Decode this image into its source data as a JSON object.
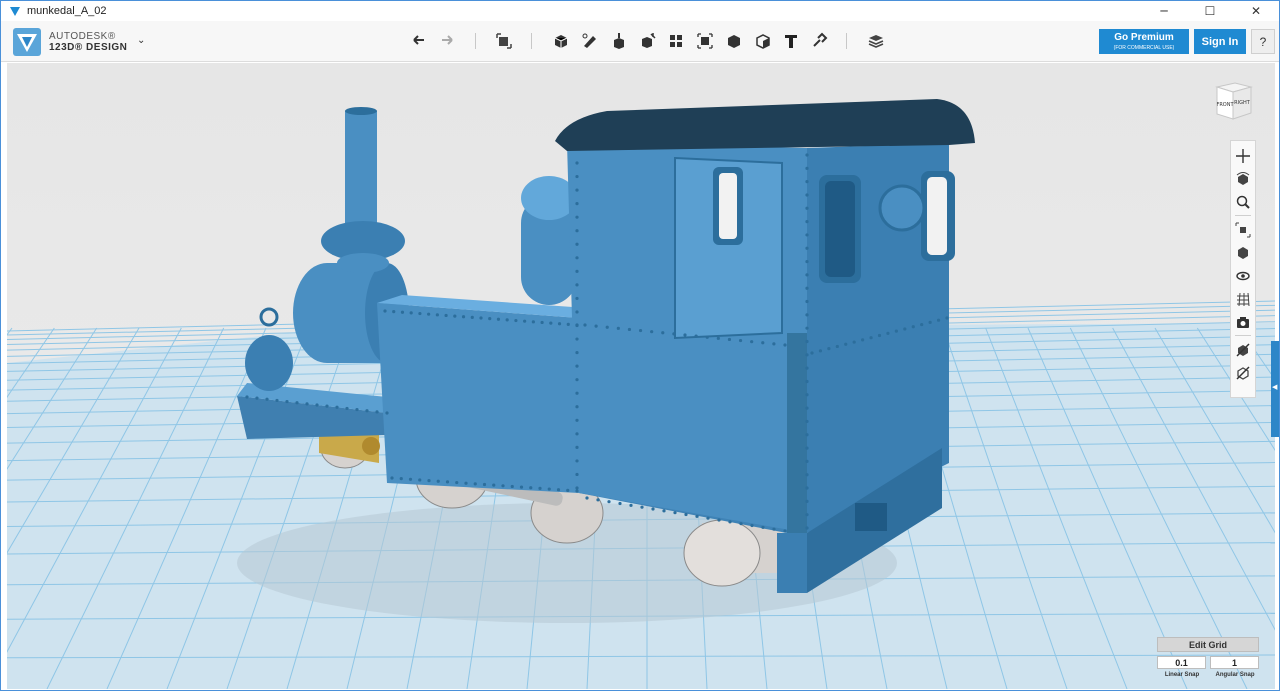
{
  "window": {
    "title": "munkedal_A_02",
    "controls": {
      "minimize": "─",
      "maximize": "☐",
      "close": "✕"
    }
  },
  "app": {
    "brand_line1": "AUTODESK®",
    "brand_line2": "123D® DESIGN",
    "menu_chevron": "⌄"
  },
  "toolbar": {
    "icons": [
      "undo-icon",
      "redo-icon",
      "transform-icon",
      "primitives-icon",
      "sketch-icon",
      "construct-icon",
      "modify-icon",
      "pattern-icon",
      "group-icon",
      "combine-icon",
      "measure-icon",
      "text-icon",
      "snap-icon",
      "material-icon"
    ],
    "premium_label": "Go Premium",
    "premium_sub": "(FOR COMMERCIAL USE)",
    "signin_label": "Sign In",
    "help_label": "?"
  },
  "viewcube": {
    "front": "FRONT",
    "right": "RIGHT"
  },
  "navbar": {
    "icons": [
      "pan-icon",
      "orbit-icon",
      "zoom-icon",
      "fit-icon",
      "view-mode-icon",
      "visibility-icon",
      "grid-toggle-icon",
      "camera-icon",
      "material-toggle-icon",
      "outline-toggle-icon"
    ]
  },
  "side_tab_glyph": "◀",
  "grid": {
    "edit_label": "Edit Grid",
    "linear_snap_value": "0.1",
    "angular_snap_value": "1",
    "linear_snap_label": "Linear Snap",
    "angular_snap_label": "Angular Snap"
  },
  "colors": {
    "model_blue": "#4a8fc2",
    "model_dark": "#2c6e9c",
    "roof": "#1f3f56",
    "grid_line": "#8fc6e6",
    "accent": "#1f8ad2",
    "brass": "#c9a94a",
    "wheel_grey": "#d6d2cf"
  }
}
